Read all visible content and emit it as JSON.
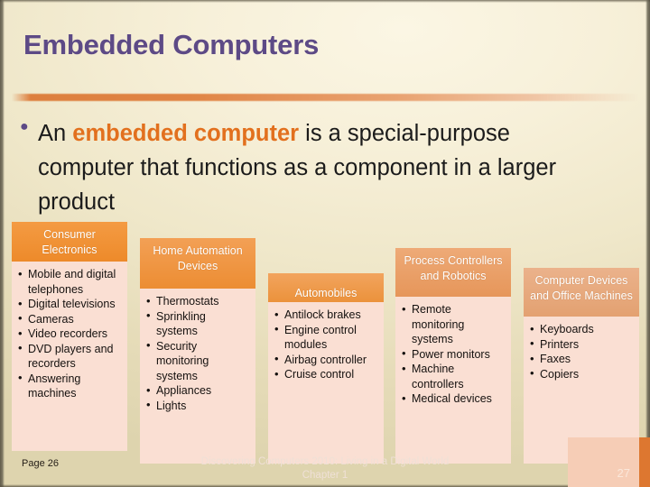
{
  "slide": {
    "title": "Embedded Computers",
    "bullet": {
      "lead": "An ",
      "highlight": "embedded computer",
      "tail": " is a special-purpose computer that functions as a component in a larger product"
    },
    "page_label_left": "Page 26",
    "page_number_right": "27",
    "footer_line1": "Discovering Computers 2010: Living in a Digital World",
    "footer_line2": "Chapter 1"
  },
  "colors": {
    "title": "#5D4A86",
    "highlight": "#E2701E",
    "accent_bar": "#DD7F3E",
    "column_body": "#FADFD3",
    "corner_stripe": "#DD7730"
  },
  "columns": [
    {
      "header": "Consumer Electronics",
      "items": [
        "Mobile and digital telephones",
        "Digital televisions",
        "Cameras",
        "Video recorders",
        "DVD players and recorders",
        "Answering machines"
      ]
    },
    {
      "header": "Home Automation Devices",
      "items": [
        "Thermostats",
        "Sprinkling systems",
        "Security monitoring systems",
        "Appliances",
        "Lights"
      ]
    },
    {
      "header": "Automobiles",
      "items": [
        "Antilock brakes",
        "Engine control modules",
        "Airbag controller",
        "Cruise control"
      ]
    },
    {
      "header": "Process Controllers and Robotics",
      "items": [
        "Remote monitoring systems",
        "Power monitors",
        "Machine controllers",
        "Medical devices"
      ]
    },
    {
      "header": "Computer Devices and Office Machines",
      "items": [
        "Keyboards",
        "Printers",
        "Faxes",
        "Copiers"
      ]
    }
  ]
}
